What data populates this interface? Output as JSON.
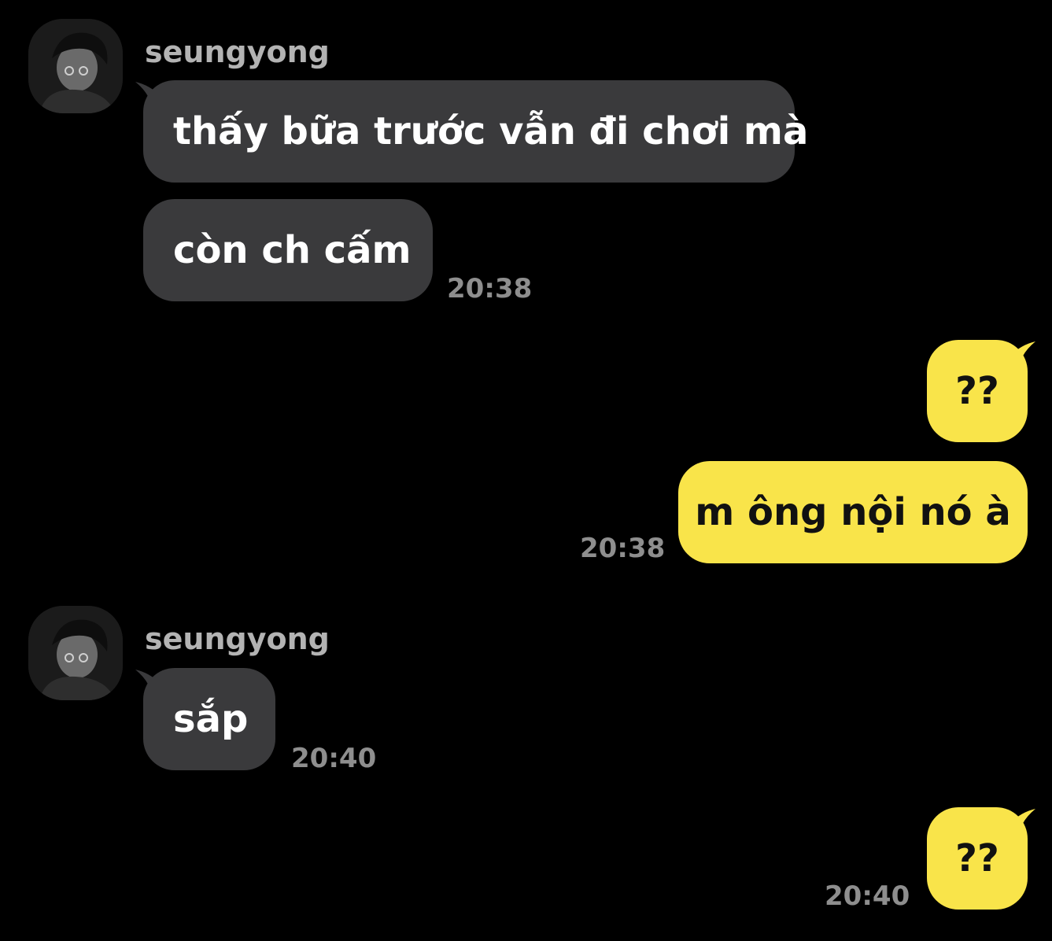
{
  "colors": {
    "background": "#000000",
    "incoming_bubble": "#3a3a3c",
    "outgoing_bubble": "#f9e44a",
    "sender_name": "#b3b3b3",
    "timestamp": "#8e8e8e"
  },
  "messages": {
    "group1": {
      "sender": "seungyong",
      "avatar_icon": "profile-photo",
      "bubbles": [
        {
          "text": "thấy bữa trước vẫn đi chơi mà"
        },
        {
          "text": "còn ch cấm"
        }
      ],
      "time": "20:38"
    },
    "group2": {
      "bubbles": [
        {
          "text": "??"
        },
        {
          "text": "m ông nội nó à"
        }
      ],
      "time": "20:38"
    },
    "group3": {
      "sender": "seungyong",
      "avatar_icon": "profile-photo",
      "bubbles": [
        {
          "text": "sắp"
        }
      ],
      "time": "20:40"
    },
    "group4": {
      "bubbles": [
        {
          "text": "??"
        }
      ],
      "time": "20:40"
    }
  }
}
